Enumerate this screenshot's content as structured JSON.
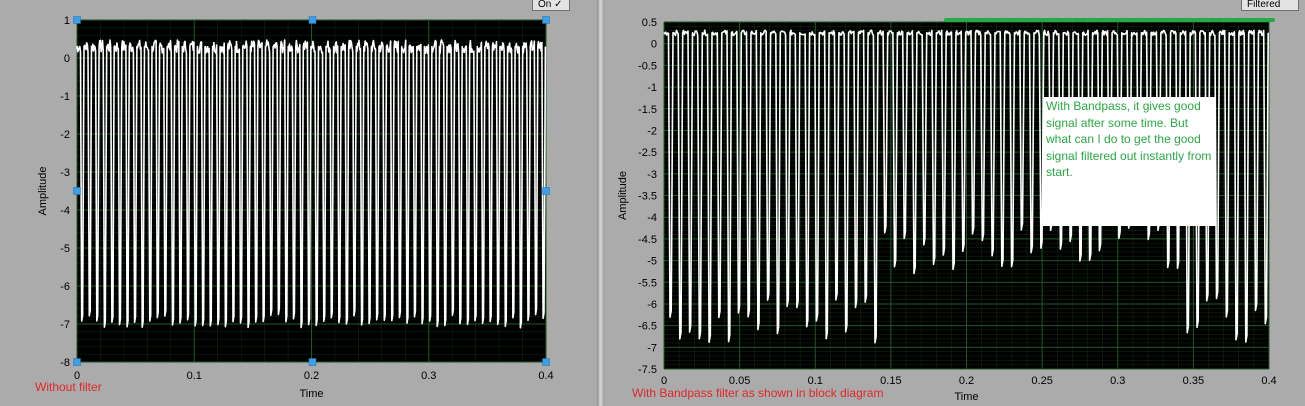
{
  "left_chart": {
    "ylabel": "Amplitude",
    "xlabel": "Time",
    "caption": "Without filter",
    "control_label": "On",
    "y_ticks": [
      "1",
      "0",
      "-1",
      "-2",
      "-3",
      "-4",
      "-5",
      "-6",
      "-7",
      "-8"
    ],
    "x_ticks": [
      "0",
      "0.1",
      "0.2",
      "0.3",
      "0.4"
    ]
  },
  "right_chart": {
    "ylabel": "Amplitude",
    "xlabel": "Time",
    "caption": "With Bandpass filter as shown in block diagram",
    "control_label": "Filtered",
    "y_ticks": [
      "0.5",
      "0",
      "-0.5",
      "-1",
      "-1.5",
      "-2",
      "-2.5",
      "-3",
      "-3.5",
      "-4",
      "-4.5",
      "-5",
      "-5.5",
      "-6",
      "-6.5",
      "-7",
      "-7.5"
    ],
    "x_ticks": [
      "0",
      "0.05",
      "0.1",
      "0.15",
      "0.2",
      "0.25",
      "0.3",
      "0.35",
      "0.4"
    ],
    "annotation": "With Bandpass, it gives good signal after some time. But what can I do to get the good signal filtered out instantly from start."
  },
  "colors": {
    "plot_bg": "#000000",
    "grid": "#1c5a26",
    "trace": "#ffffff",
    "caption": "#e0282a",
    "annotation_text": "#2aa845",
    "highlight_line": "#2aa845",
    "selection_handle": "#3aa0e8"
  },
  "chart_data": [
    {
      "type": "line",
      "title": "",
      "xlabel": "Time",
      "ylabel": "Amplitude",
      "xlim": [
        0,
        0.4
      ],
      "ylim": [
        -8,
        1
      ],
      "grid": true,
      "series": [
        {
          "pulses": 62,
          "high_level": 0.3,
          "low_level_range": [
            -7.1,
            -6.2
          ]
        }
      ]
    },
    {
      "type": "line",
      "title": "",
      "xlabel": "Time",
      "ylabel": "Amplitude",
      "xlim": [
        0,
        0.4
      ],
      "ylim": [
        -7.5,
        0.5
      ],
      "grid": true,
      "series": [
        {
          "pulses": 62,
          "high_level": 0.25,
          "low_level_range": [
            -6.9,
            -4.3
          ]
        }
      ]
    }
  ]
}
